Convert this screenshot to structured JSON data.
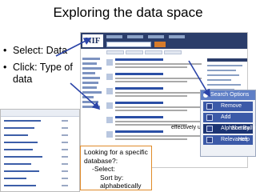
{
  "slide": {
    "title": "Exploring the data space",
    "bullets": [
      {
        "text": "Select: Data"
      },
      {
        "text": "Click: Type of data"
      }
    ]
  },
  "callout": {
    "line1": "Looking for a specific database?:",
    "line2": "-Select:",
    "line3": "Sort by: alphabetically"
  },
  "search_options": {
    "title": "Search Options",
    "items": [
      "Remove",
      "Add",
      "Alphabetically",
      "Relevance"
    ],
    "right_labels": [
      "",
      "",
      "Sort By",
      "Help"
    ]
  },
  "partial_text": "effectively utilize Molecular",
  "colors": {
    "nif_header": "#2b3d6a",
    "callout_border": "#e08b2a",
    "arrow": "#2b44a8",
    "menu_item": "#3c5aa8",
    "menu_header": "#5f7fc6"
  },
  "icons": [
    "nif-logo",
    "arrow-icon",
    "checkbox-icon"
  ]
}
